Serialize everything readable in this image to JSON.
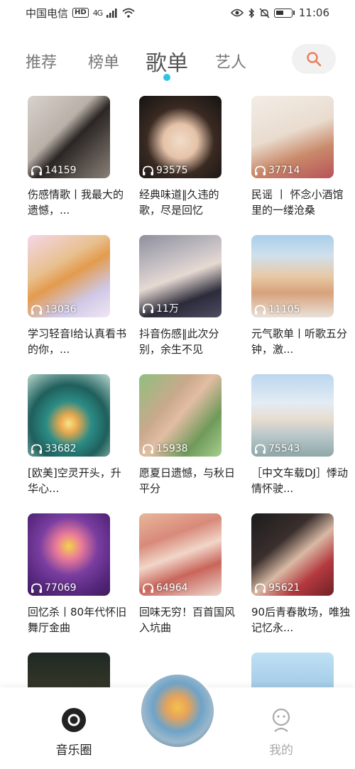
{
  "status_bar": {
    "carrier": "中国电信",
    "hd": "HD",
    "network": "4G",
    "time": "11:06"
  },
  "tabs": [
    {
      "label": "推荐",
      "active": false
    },
    {
      "label": "榜单",
      "active": false
    },
    {
      "label": "歌单",
      "active": true
    },
    {
      "label": "艺人",
      "active": false
    }
  ],
  "accent_color": "#2ec5de",
  "search_icon_color": "#ef7a5a",
  "playlists": [
    {
      "count": "14159",
      "title": "伤感情歌丨我最大的遗憾，..."
    },
    {
      "count": "93575",
      "title": "经典味道‖久违的歌，尽是回忆"
    },
    {
      "count": "37714",
      "title": "民谣 丨 怀念小酒馆里的一缕沧桑"
    },
    {
      "count": "13036",
      "title": "学习轻音l给认真看书的你，..."
    },
    {
      "count": "11万",
      "title": "抖音伤感‖此次分别，余生不见"
    },
    {
      "count": "11105",
      "title": "元气歌单丨听歌五分钟，激..."
    },
    {
      "count": "33682",
      "title": "[欧美]空灵开头，升华心..."
    },
    {
      "count": "15938",
      "title": "愿夏日遗憾，与秋日平分"
    },
    {
      "count": "75543",
      "title": "［中文车载DJ］悸动情怀驶..."
    },
    {
      "count": "77069",
      "title": "回忆杀丨80年代怀旧舞厅金曲"
    },
    {
      "count": "64964",
      "title": "回味无穷！百首国风入坑曲"
    },
    {
      "count": "95621",
      "title": "90后青春散场，唯独记忆永..."
    }
  ],
  "bottom_nav": {
    "left_label": "音乐圈",
    "right_label": "我的"
  }
}
